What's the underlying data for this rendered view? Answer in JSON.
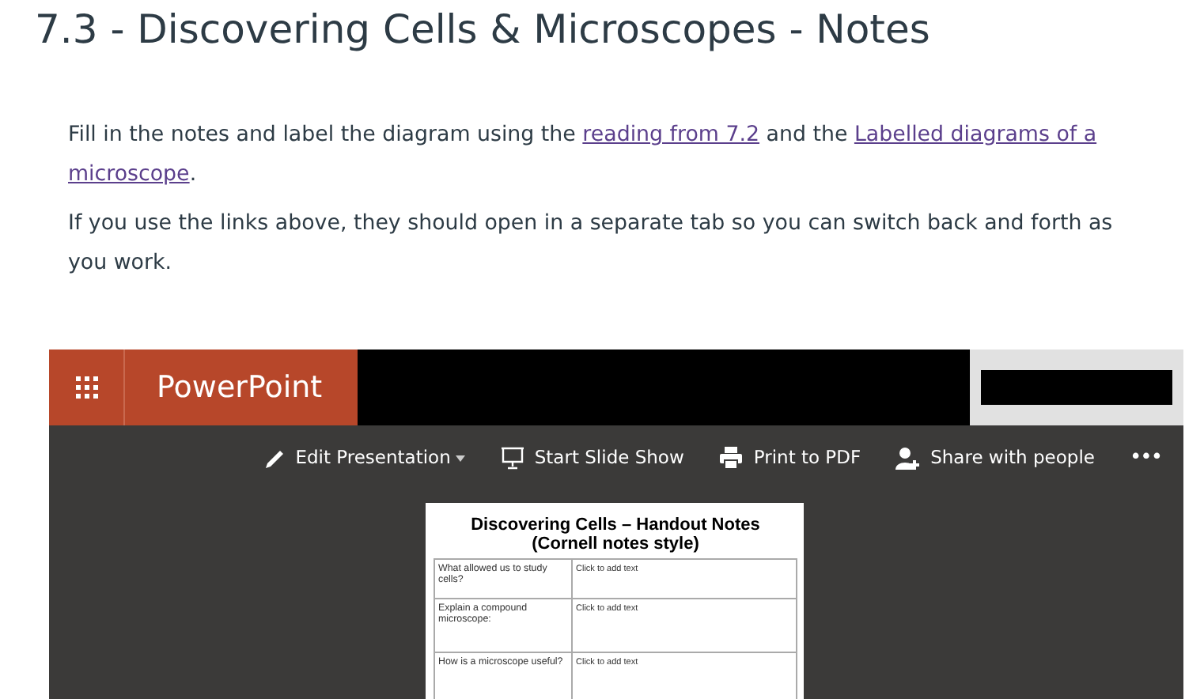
{
  "heading": "7.3 - Discovering Cells & Microscopes - Notes",
  "paragraphs": [
    {
      "parts": [
        {
          "text": "Fill in the notes and label the diagram using the "
        },
        {
          "text": "reading from 7.2",
          "link": true
        },
        {
          "text": " and the "
        },
        {
          "text": "Labelled diagrams of a",
          "link": true
        },
        {
          "text": "microscope",
          "link": true
        },
        {
          "text": "."
        }
      ]
    },
    {
      "parts": [
        {
          "text": "If you use the links above, they should open in a separate tab so you can switch back and forth as you work."
        }
      ]
    }
  ],
  "embed": {
    "app_name": "PowerPoint",
    "toolbar": [
      {
        "kind": "edit",
        "label": "Edit Presentation",
        "dropdown": true
      },
      {
        "kind": "slideshow",
        "label": "Start Slide Show",
        "dropdown": false
      },
      {
        "kind": "print",
        "label": "Print to PDF",
        "dropdown": false
      },
      {
        "kind": "share",
        "label": "Share with people",
        "dropdown": false
      },
      {
        "kind": "more",
        "label": "•••",
        "dropdown": false
      }
    ],
    "slide": {
      "title": "Discovering Cells – Handout Notes",
      "subtitle": "(Cornell notes style)",
      "rows": [
        {
          "question": "What allowed us to study cells?",
          "answer": "Click to add text"
        },
        {
          "question": "Explain a compound microscope:",
          "answer": "Click to add text"
        },
        {
          "question": "How is a microscope useful?",
          "answer": "Click to add text"
        }
      ]
    }
  }
}
